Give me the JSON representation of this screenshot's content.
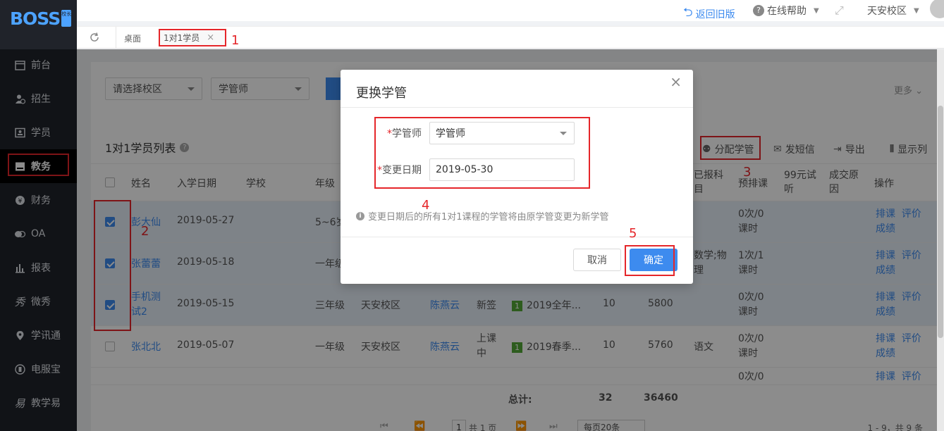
{
  "app": {
    "logo": "BOSS",
    "logo_badge": "校长"
  },
  "sidebar": {
    "items": [
      {
        "label": "前台",
        "icon": "calendar-icon"
      },
      {
        "label": "招生",
        "icon": "user-plus-icon"
      },
      {
        "label": "学员",
        "icon": "id-card-icon"
      },
      {
        "label": "教务",
        "icon": "book-icon",
        "active": true
      },
      {
        "label": "财务",
        "icon": "yen-icon"
      },
      {
        "label": "OA",
        "icon": "chat-icon"
      },
      {
        "label": "报表",
        "icon": "bar-chart-icon"
      },
      {
        "label": "微秀",
        "icon": "xiu-icon"
      },
      {
        "label": "学讯通",
        "icon": "location-icon"
      },
      {
        "label": "电服宝",
        "icon": "phone-icon"
      },
      {
        "label": "教学易",
        "icon": "teach-icon"
      }
    ]
  },
  "header": {
    "back_old": "返回旧版",
    "help": "在线帮助",
    "campus": "天安校区"
  },
  "tabs": {
    "home": "桌面",
    "active": "1对1学员",
    "close": "×"
  },
  "filters": {
    "campus_placeholder": "请选择校区",
    "manager": "学管师",
    "more": "更多"
  },
  "list": {
    "title": "1对1学员列表",
    "help": "?",
    "actions": {
      "assign": "分配学管",
      "sms": "发短信",
      "export": "导出",
      "columns": "显示列"
    },
    "headers": {
      "name": "姓名",
      "enroll_date": "入学日期",
      "school": "学校",
      "grade": "年级",
      "enrolled_subjects_1": "已报科",
      "enrolled_subjects_2": "目",
      "pre_schedule": "预排课",
      "trial_1": "99元试",
      "trial_2": "听",
      "reason_1": "成交原",
      "reason_2": "因",
      "ops": "操作"
    },
    "rows": [
      {
        "checked": true,
        "name": "彭大仙",
        "date": "2019-05-27",
        "grade": "5~6岁",
        "campus": "",
        "manager": "",
        "status": "",
        "course": "",
        "hours": "",
        "amount": "",
        "subjects": "",
        "pre_1": "0次/0",
        "pre_2": "课时",
        "op1": "排课",
        "op2": "评价",
        "op3": "成绩"
      },
      {
        "checked": true,
        "name": "张蕾蕾",
        "date": "2019-05-18",
        "grade": "一年级",
        "campus": "",
        "manager": "",
        "status": "",
        "course": "",
        "hours": "",
        "amount": "",
        "subjects_1": "数学;物",
        "subjects_2": "理",
        "pre_1": "1次/1",
        "pre_2": "课时",
        "op1": "排课",
        "op2": "评价",
        "op3": "成绩"
      },
      {
        "checked": true,
        "name_1": "手机测",
        "name_2": "试2",
        "date": "2019-05-15",
        "grade": "三年级",
        "campus": "天安校区",
        "manager": "陈燕云",
        "status": "新签",
        "course": "2019全年...",
        "tag": "1",
        "hours": "10",
        "amount": "5800",
        "subjects": "",
        "pre_1": "0次/0",
        "pre_2": "课时",
        "op1": "排课",
        "op2": "评价",
        "op3": "成绩"
      },
      {
        "checked": false,
        "name": "张北北",
        "date": "2019-05-07",
        "grade": "一年级",
        "campus": "天安校区",
        "manager": "陈燕云",
        "status_1": "上课",
        "status_2": "中",
        "course": "2019春季...",
        "tag": "1",
        "hours": "10",
        "amount": "5760",
        "subjects": "语文",
        "pre_1": "0次/0",
        "pre_2": "课时",
        "op1": "排课",
        "op2": "评价",
        "op3": "成绩"
      },
      {
        "checked": false,
        "pre_1": "0次/0",
        "op1": "排课",
        "op2": "评价"
      }
    ],
    "totals": {
      "label": "总计:",
      "hours": "32",
      "amount": "36460"
    },
    "pager": {
      "page": "1",
      "total_pages": "共 1 页",
      "per_page": "每页20条",
      "summary": "1 - 9，共 9 条"
    }
  },
  "modal": {
    "title": "更换学管",
    "close": "×",
    "manager_label": "学管师",
    "manager_value": "学管师",
    "date_label": "变更日期",
    "date_value": "2019-05-30",
    "note": "变更日期后的所有1对1课程的学管将由原学管变更为新学管",
    "cancel": "取消",
    "ok": "确定"
  },
  "annotations": {
    "n1": "1",
    "n2": "2",
    "n3": "3",
    "n4": "4",
    "n5": "5"
  },
  "colors": {
    "accent": "#3d8bef",
    "sidebar_bg": "#20232a",
    "highlight": "#e5262a",
    "tag_green": "#52a838"
  }
}
